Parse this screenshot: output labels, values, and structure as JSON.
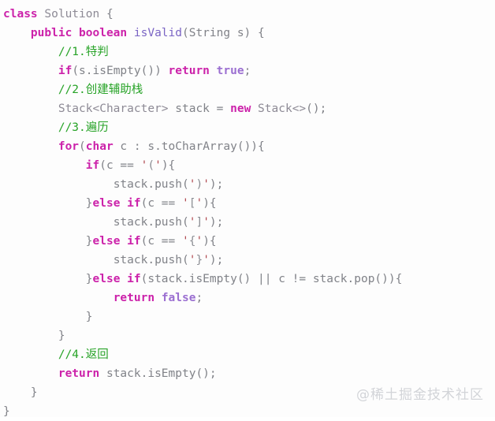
{
  "editor": {
    "language": "java",
    "background_color": "#fdfdfd",
    "line_height_px": 24,
    "font_size_px": 14.5
  },
  "colors": {
    "keyword": "#cc22aa",
    "plain": "#808288",
    "type": "#8d8a95",
    "method": "#7a64c4",
    "literal": "#9b6fd1",
    "comment": "#27a327",
    "string": "#b0484f",
    "watermark": "#d2d4d8"
  },
  "code": {
    "lines": [
      {
        "indent": "",
        "tokens": [
          {
            "cls": "t-kw",
            "text": "class"
          },
          {
            "cls": "t-plain",
            "text": " "
          },
          {
            "cls": "t-type",
            "text": "Solution"
          },
          {
            "cls": "t-plain",
            "text": " {"
          }
        ]
      },
      {
        "indent": "    ",
        "tokens": [
          {
            "cls": "t-kw",
            "text": "public boolean"
          },
          {
            "cls": "t-plain",
            "text": " "
          },
          {
            "cls": "t-method",
            "text": "isValid"
          },
          {
            "cls": "t-plain",
            "text": "(String s) {"
          }
        ]
      },
      {
        "indent": "        ",
        "tokens": [
          {
            "cls": "t-comment",
            "text": "//1.特判"
          }
        ]
      },
      {
        "indent": "        ",
        "tokens": [
          {
            "cls": "t-kw",
            "text": "if"
          },
          {
            "cls": "t-plain",
            "text": "(s.isEmpty()) "
          },
          {
            "cls": "t-kw",
            "text": "return"
          },
          {
            "cls": "t-plain",
            "text": " "
          },
          {
            "cls": "t-lit",
            "text": "true"
          },
          {
            "cls": "t-plain",
            "text": ";"
          }
        ]
      },
      {
        "indent": "        ",
        "tokens": [
          {
            "cls": "t-comment",
            "text": "//2.创建辅助栈"
          }
        ]
      },
      {
        "indent": "        ",
        "tokens": [
          {
            "cls": "t-type",
            "text": "Stack<Character>"
          },
          {
            "cls": "t-plain",
            "text": " stack = "
          },
          {
            "cls": "t-kw",
            "text": "new"
          },
          {
            "cls": "t-plain",
            "text": " "
          },
          {
            "cls": "t-type",
            "text": "Stack<>"
          },
          {
            "cls": "t-plain",
            "text": "();"
          }
        ]
      },
      {
        "indent": "        ",
        "tokens": [
          {
            "cls": "t-comment",
            "text": "//3.遍历"
          }
        ]
      },
      {
        "indent": "        ",
        "tokens": [
          {
            "cls": "t-kw",
            "text": "for"
          },
          {
            "cls": "t-plain",
            "text": "("
          },
          {
            "cls": "t-kw",
            "text": "char"
          },
          {
            "cls": "t-plain",
            "text": " c : s.toCharArray()){"
          }
        ]
      },
      {
        "indent": "            ",
        "tokens": [
          {
            "cls": "t-kw",
            "text": "if"
          },
          {
            "cls": "t-plain",
            "text": "(c == "
          },
          {
            "cls": "t-str",
            "text": "'"
          },
          {
            "cls": "t-strinner",
            "text": "("
          },
          {
            "cls": "t-str",
            "text": "'"
          },
          {
            "cls": "t-plain",
            "text": "){"
          }
        ]
      },
      {
        "indent": "                ",
        "tokens": [
          {
            "cls": "t-plain",
            "text": "stack.push("
          },
          {
            "cls": "t-str",
            "text": "'"
          },
          {
            "cls": "t-strinner",
            "text": ")"
          },
          {
            "cls": "t-str",
            "text": "'"
          },
          {
            "cls": "t-plain",
            "text": ");"
          }
        ]
      },
      {
        "indent": "            ",
        "tokens": [
          {
            "cls": "t-plain",
            "text": "}"
          },
          {
            "cls": "t-kw",
            "text": "else if"
          },
          {
            "cls": "t-plain",
            "text": "(c == "
          },
          {
            "cls": "t-str",
            "text": "'"
          },
          {
            "cls": "t-strinner",
            "text": "["
          },
          {
            "cls": "t-str",
            "text": "'"
          },
          {
            "cls": "t-plain",
            "text": "){"
          }
        ]
      },
      {
        "indent": "                ",
        "tokens": [
          {
            "cls": "t-plain",
            "text": "stack.push("
          },
          {
            "cls": "t-str",
            "text": "'"
          },
          {
            "cls": "t-strinner",
            "text": "]"
          },
          {
            "cls": "t-str",
            "text": "'"
          },
          {
            "cls": "t-plain",
            "text": ");"
          }
        ]
      },
      {
        "indent": "            ",
        "tokens": [
          {
            "cls": "t-plain",
            "text": "}"
          },
          {
            "cls": "t-kw",
            "text": "else if"
          },
          {
            "cls": "t-plain",
            "text": "(c == "
          },
          {
            "cls": "t-str",
            "text": "'"
          },
          {
            "cls": "t-strinner",
            "text": "{"
          },
          {
            "cls": "t-str",
            "text": "'"
          },
          {
            "cls": "t-plain",
            "text": "){"
          }
        ]
      },
      {
        "indent": "                ",
        "tokens": [
          {
            "cls": "t-plain",
            "text": "stack.push("
          },
          {
            "cls": "t-str",
            "text": "'"
          },
          {
            "cls": "t-strinner",
            "text": "}"
          },
          {
            "cls": "t-str",
            "text": "'"
          },
          {
            "cls": "t-plain",
            "text": ");"
          }
        ]
      },
      {
        "indent": "            ",
        "tokens": [
          {
            "cls": "t-plain",
            "text": "}"
          },
          {
            "cls": "t-kw",
            "text": "else if"
          },
          {
            "cls": "t-plain",
            "text": "(stack.isEmpty() || c != stack.pop()){"
          }
        ]
      },
      {
        "indent": "                ",
        "tokens": [
          {
            "cls": "t-kw",
            "text": "return"
          },
          {
            "cls": "t-plain",
            "text": " "
          },
          {
            "cls": "t-lit",
            "text": "false"
          },
          {
            "cls": "t-plain",
            "text": ";"
          }
        ]
      },
      {
        "indent": "            ",
        "tokens": [
          {
            "cls": "t-plain",
            "text": "}"
          }
        ]
      },
      {
        "indent": "        ",
        "tokens": [
          {
            "cls": "t-plain",
            "text": "}"
          }
        ]
      },
      {
        "indent": "        ",
        "tokens": [
          {
            "cls": "t-comment",
            "text": "//4.返回"
          }
        ]
      },
      {
        "indent": "        ",
        "tokens": [
          {
            "cls": "t-kw",
            "text": "return"
          },
          {
            "cls": "t-plain",
            "text": " stack.isEmpty();"
          }
        ]
      },
      {
        "indent": "    ",
        "tokens": [
          {
            "cls": "t-plain",
            "text": "}"
          }
        ]
      },
      {
        "indent": "",
        "tokens": [
          {
            "cls": "t-plain",
            "text": "}"
          }
        ]
      }
    ]
  },
  "watermark": {
    "text": "@稀土掘金技术社区"
  }
}
